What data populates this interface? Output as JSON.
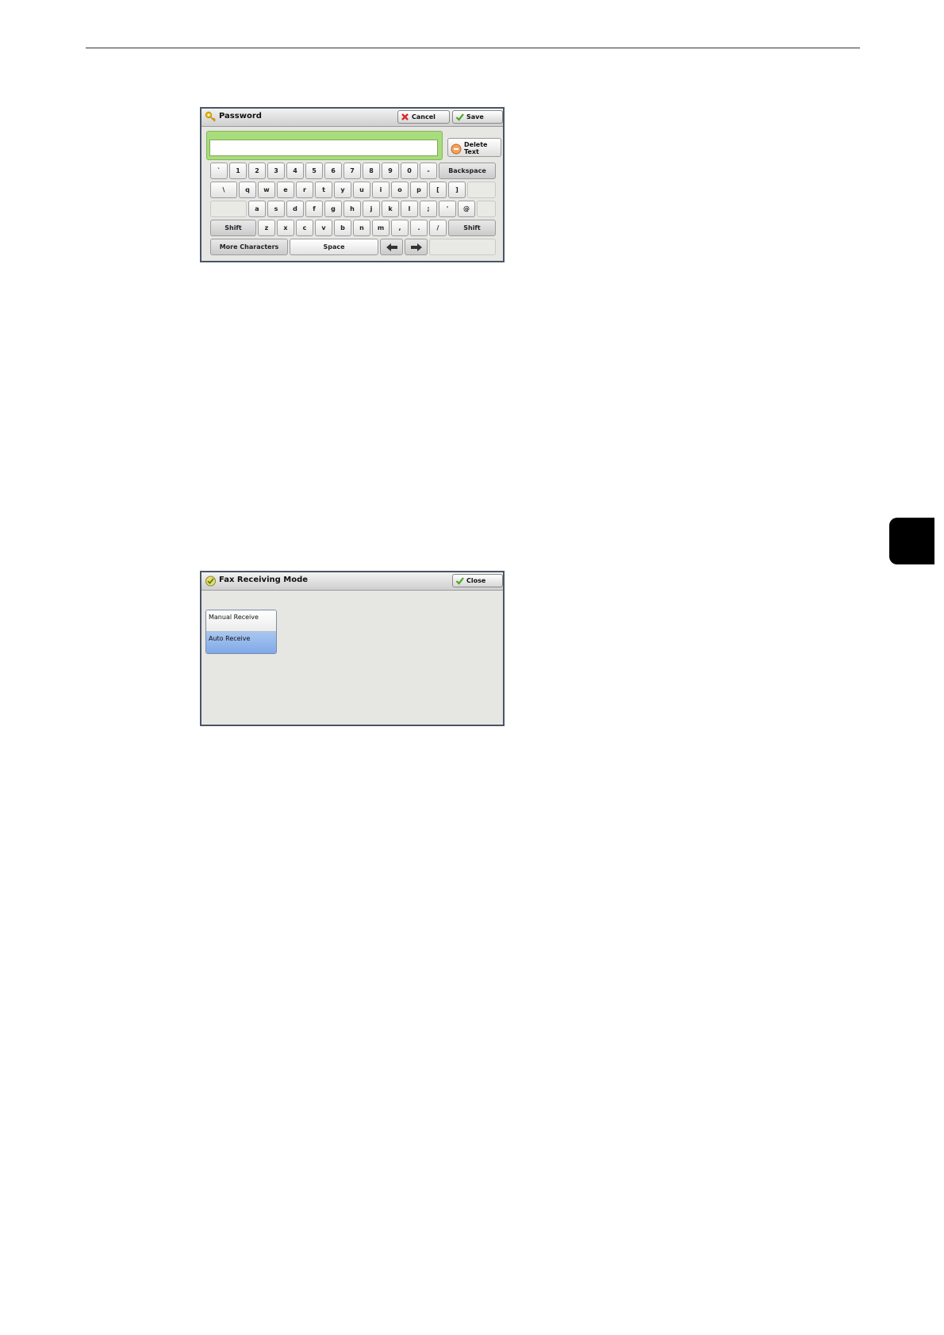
{
  "password_dialog": {
    "title": "Password",
    "title_icon": "key-icon",
    "cancel_label": "Cancel",
    "save_label": "Save",
    "input_value": "",
    "delete_text_label": "Delete Text",
    "keyboard": {
      "row1": [
        "`",
        "1",
        "2",
        "3",
        "4",
        "5",
        "6",
        "7",
        "8",
        "9",
        "0",
        "-"
      ],
      "backspace_label": "Backspace",
      "row2": [
        "\\",
        "q",
        "w",
        "e",
        "r",
        "t",
        "y",
        "u",
        "i",
        "o",
        "p",
        "[",
        "]"
      ],
      "row3": [
        "a",
        "s",
        "d",
        "f",
        "g",
        "h",
        "j",
        "k",
        "l",
        ";",
        "'",
        "@"
      ],
      "shift_label": "Shift",
      "row4": [
        "z",
        "x",
        "c",
        "v",
        "b",
        "n",
        "m",
        ",",
        ".",
        "/"
      ],
      "more_characters_label": "More Characters",
      "space_label": "Space"
    }
  },
  "fax_dialog": {
    "title": "Fax Receiving Mode",
    "title_icon": "fax-mode-icon",
    "close_label": "Close",
    "options": [
      "Manual Receive",
      "Auto Receive"
    ],
    "selected": "Auto Receive"
  },
  "colors": {
    "selected_option": "#80a9e8",
    "input_highlight": "#a8dc7c",
    "chapter_tab": "#000000"
  }
}
